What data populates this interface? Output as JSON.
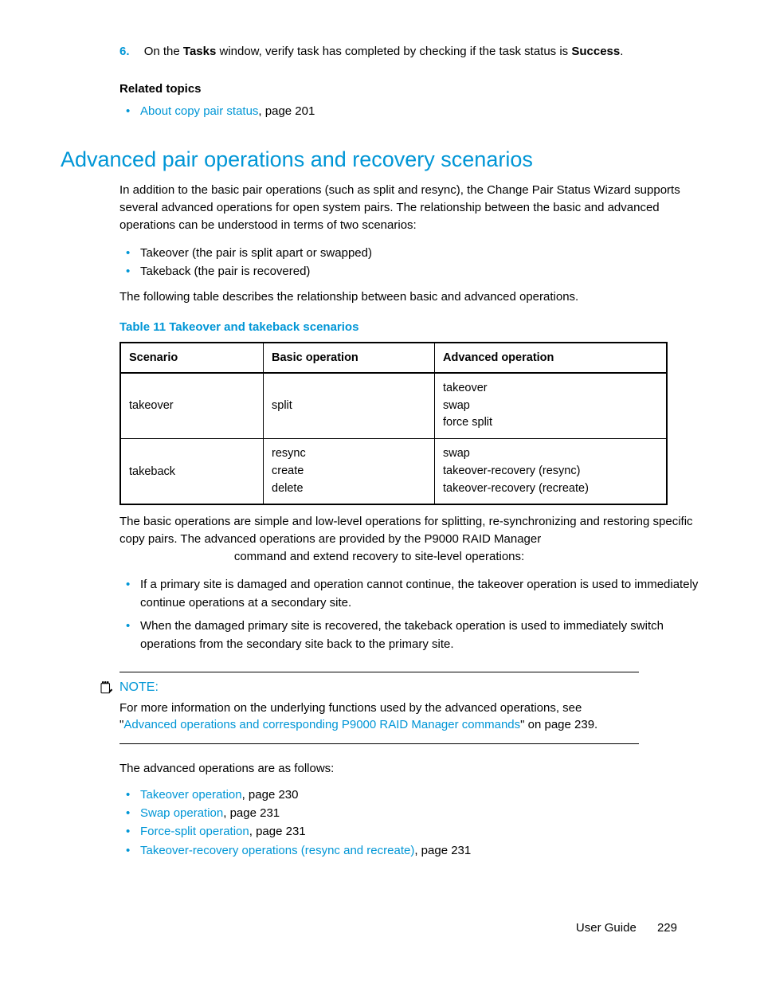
{
  "step6": {
    "num": "6.",
    "pre": "On the ",
    "win": "Tasks",
    "mid": " window, verify task has completed by checking if the task status is ",
    "status": "Success",
    "post": "."
  },
  "related": {
    "heading": "Related topics",
    "items": [
      {
        "link": "About copy pair status",
        "suffix": ", page 201"
      }
    ]
  },
  "section": {
    "title": "Advanced pair operations and recovery scenarios",
    "intro": "In addition to the basic pair operations (such as split and resync), the Change Pair Status Wizard supports several advanced operations for open system pairs. The relationship between the basic and advanced operations can be understood in terms of two scenarios:",
    "scenarios": [
      "Takeover (the pair is split apart or swapped)",
      "Takeback (the pair is recovered)"
    ],
    "table_lead": "The following table describes the relationship between basic and advanced operations.",
    "table_caption": "Table 11 Takeover and takeback scenarios",
    "table": {
      "headers": [
        "Scenario",
        "Basic operation",
        "Advanced operation"
      ],
      "rows": [
        {
          "scenario": "takeover",
          "basic": [
            "split"
          ],
          "advanced": [
            "takeover",
            "swap",
            "force split"
          ]
        },
        {
          "scenario": "takeback",
          "basic": [
            "resync",
            "create",
            "delete"
          ],
          "advanced": [
            "swap",
            "takeover-recovery (resync)",
            "takeover-recovery (recreate)"
          ]
        }
      ]
    },
    "after_table_1": "The basic operations are simple and low-level operations for splitting, re-synchronizing and restoring specific copy pairs. The advanced operations are provided by the P9000 RAID Manager",
    "after_table_2": "command and extend recovery to site-level operations:",
    "site_points": [
      "If a primary site is damaged and operation cannot continue, the takeover operation is used to immediately continue operations at a secondary site.",
      "When the damaged primary site is recovered, the takeback operation is used to immediately switch operations from the secondary site back to the primary site."
    ],
    "note": {
      "label": "NOTE:",
      "pre": "For more information on the underlying functions used by the advanced operations, see \"",
      "link": "Advanced operations and corresponding P9000 RAID Manager commands",
      "post": "\" on page 239."
    },
    "adv_lead": "The advanced operations are as follows:",
    "adv_ops": [
      {
        "link": "Takeover operation",
        "suffix": ", page 230"
      },
      {
        "link": "Swap operation",
        "suffix": ", page 231"
      },
      {
        "link": "Force-split operation",
        "suffix": ", page 231"
      },
      {
        "link": "Takeover-recovery operations (resync and recreate)",
        "suffix": ", page 231"
      }
    ]
  },
  "footer": {
    "label": "User Guide",
    "page": "229"
  }
}
